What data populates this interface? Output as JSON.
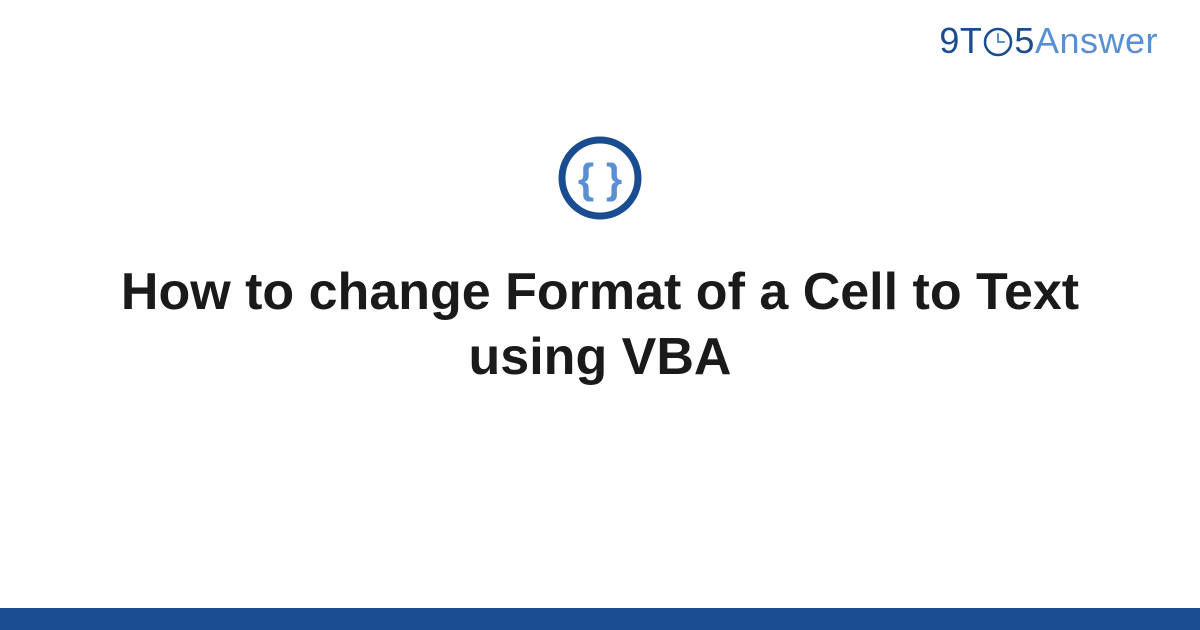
{
  "logo": {
    "part1": "9T",
    "part2": "5",
    "part3": "Answer"
  },
  "title": "How to change Format of a Cell to Text using VBA",
  "colors": {
    "brand_dark": "#1a4d8f",
    "brand_light": "#5a8fd4",
    "text": "#1a1a1a"
  }
}
